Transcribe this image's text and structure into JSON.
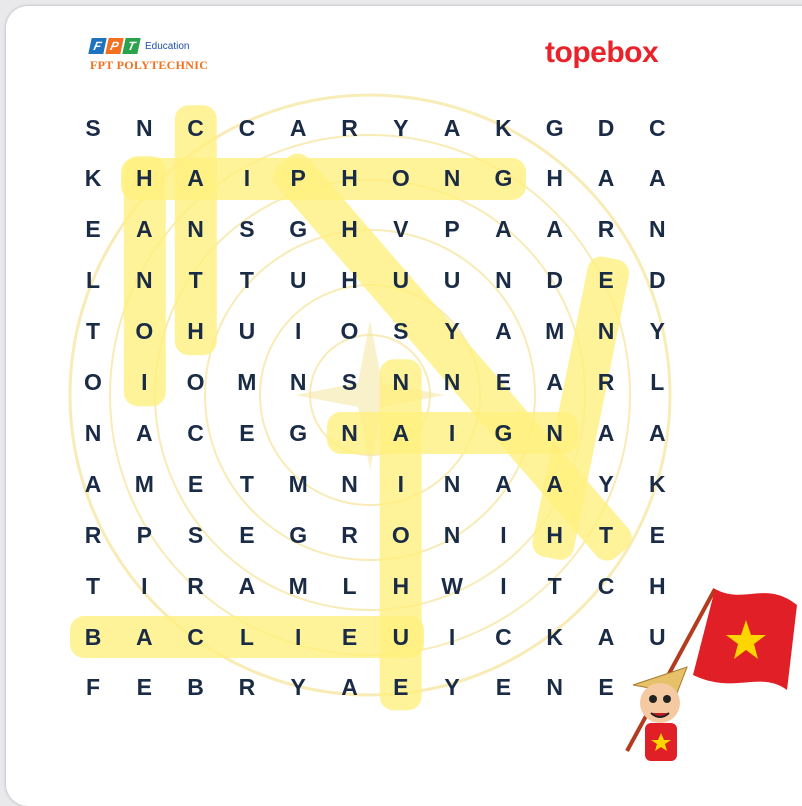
{
  "brand": {
    "fpt_letters": [
      "F",
      "P",
      "T"
    ],
    "fpt_colors": [
      "#1e73be",
      "#f2701f",
      "#2ba24c"
    ],
    "education": "Education",
    "polytechnic": "FPT POLYTECHNIC",
    "topebox": "topebox"
  },
  "grid": [
    [
      "S",
      "N",
      "C",
      "C",
      "A",
      "R",
      "Y",
      "A",
      "K",
      "G",
      "D",
      "C"
    ],
    [
      "K",
      "H",
      "A",
      "I",
      "P",
      "H",
      "O",
      "N",
      "G",
      "H",
      "A",
      "A"
    ],
    [
      "E",
      "A",
      "N",
      "S",
      "G",
      "H",
      "V",
      "P",
      "A",
      "A",
      "R",
      "N"
    ],
    [
      "L",
      "N",
      "T",
      "T",
      "U",
      "H",
      "U",
      "U",
      "N",
      "D",
      "E",
      "D"
    ],
    [
      "T",
      "O",
      "H",
      "U",
      "I",
      "O",
      "S",
      "Y",
      "A",
      "M",
      "N",
      "Y"
    ],
    [
      "O",
      "I",
      "O",
      "M",
      "N",
      "S",
      "N",
      "N",
      "E",
      "A",
      "R",
      "L"
    ],
    [
      "N",
      "A",
      "C",
      "E",
      "G",
      "N",
      "A",
      "I",
      "G",
      "N",
      "A",
      "A"
    ],
    [
      "A",
      "M",
      "E",
      "T",
      "M",
      "N",
      "I",
      "N",
      "A",
      "A",
      "Y",
      "K"
    ],
    [
      "R",
      "P",
      "S",
      "E",
      "G",
      "R",
      "O",
      "N",
      "I",
      "H",
      "T",
      "E"
    ],
    [
      "T",
      "I",
      "R",
      "A",
      "M",
      "L",
      "H",
      "W",
      "I",
      "T",
      "C",
      "H"
    ],
    [
      "B",
      "A",
      "C",
      "L",
      "I",
      "E",
      "U",
      "I",
      "C",
      "K",
      "A",
      "U"
    ],
    [
      "F",
      "E",
      "B",
      "R",
      "Y",
      "A",
      "E",
      "Y",
      "E",
      "N",
      "E",
      ""
    ]
  ],
  "highlight_color": "#fff07c"
}
